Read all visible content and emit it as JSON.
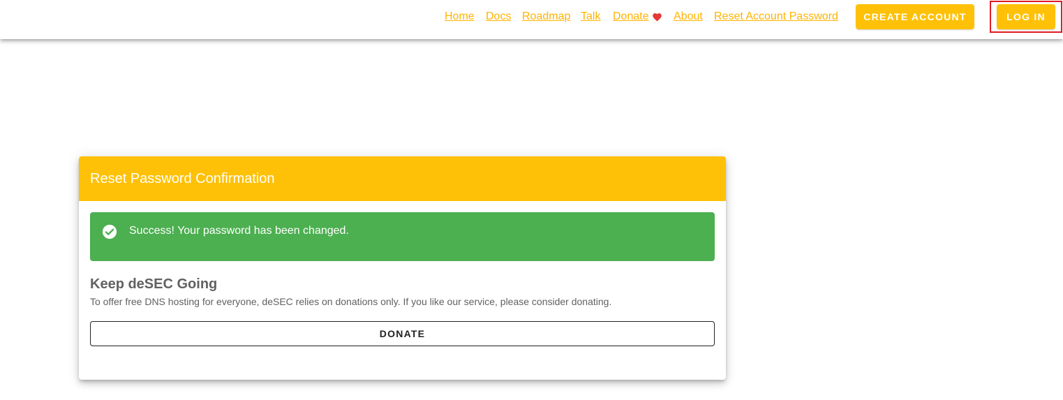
{
  "nav": {
    "links": [
      "Home",
      "Docs",
      "Roadmap",
      "Talk",
      "Donate",
      "About",
      "Reset Account Password"
    ],
    "create_account_label": "CREATE ACCOUNT",
    "login_label": "LOG IN"
  },
  "card": {
    "title": "Reset Password Confirmation",
    "alert_text": "Success! Your password has been changed.",
    "section_title": "Keep deSEC Going",
    "section_text": "To offer free DNS hosting for everyone, deSEC relies on donations only. If you like our service, please consider donating.",
    "donate_label": "DONATE"
  },
  "colors": {
    "accent": "#ffc107",
    "link": "#ffb300",
    "success": "#4caf50",
    "heart": "#e53935",
    "highlight": "#e01b24"
  },
  "icons": {
    "heart": "heart-icon",
    "check": "check-circle-icon"
  }
}
